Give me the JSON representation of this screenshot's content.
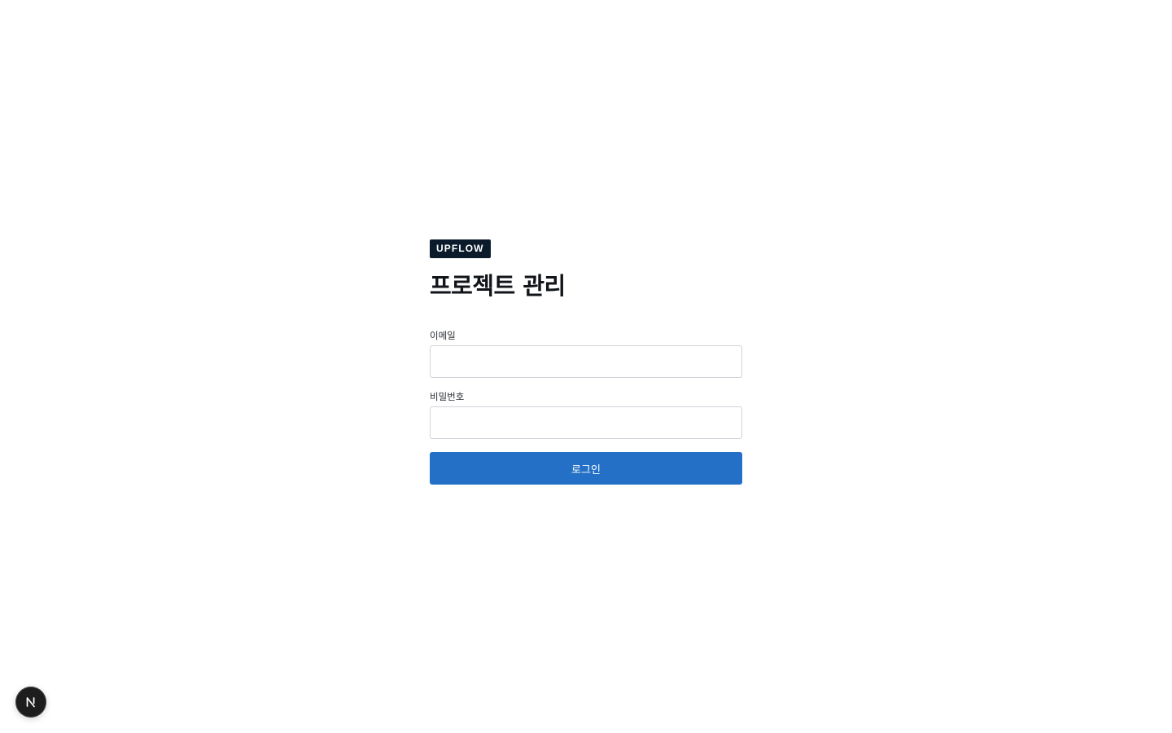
{
  "brand": {
    "badge_text": "UPFLOW"
  },
  "page": {
    "title": "프로젝트 관리"
  },
  "form": {
    "email": {
      "label": "이메일",
      "value": "",
      "placeholder": ""
    },
    "password": {
      "label": "비밀번호",
      "value": "",
      "placeholder": ""
    },
    "submit_label": "로그인"
  },
  "dev_indicator": {
    "icon": "nextjs-logo-icon"
  },
  "colors": {
    "badge_bg": "#0b1b2b",
    "primary_button": "#2370c6",
    "input_border": "#cfd3d8",
    "text": "#111418"
  }
}
